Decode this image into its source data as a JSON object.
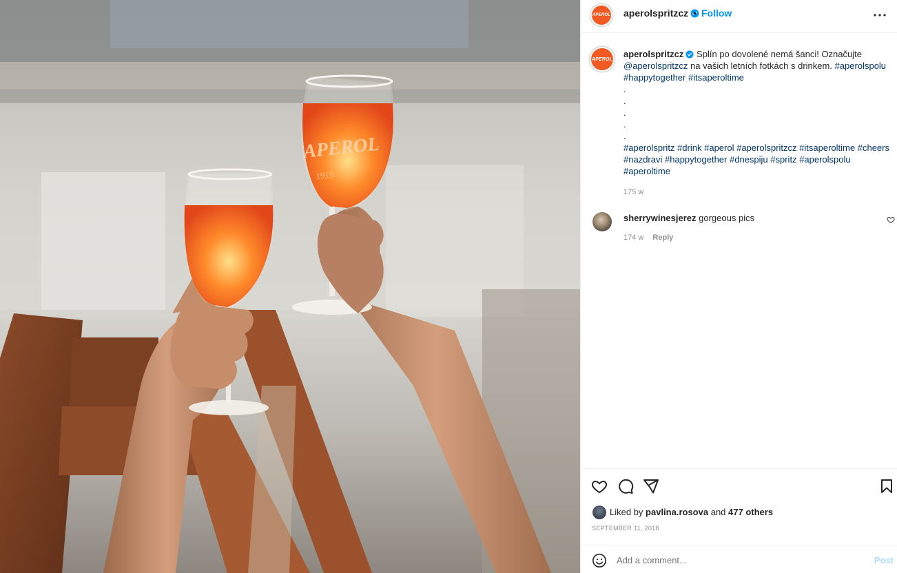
{
  "post": {
    "username": "aperolspritzcz",
    "avatar_text": "APEROL",
    "follow_label": "Follow",
    "dot": "•",
    "caption": {
      "text_1": "Splín po dovolené nemá šanci! Označujte",
      "mention": "@aperolspritzcz",
      "text_2": "na vašich letních fotkách s drinkem.",
      "tags_line1": [
        "#aperolspolu",
        "#happytogether",
        "#itsaperoltime"
      ],
      "dots": [
        ".",
        ".",
        ".",
        ".",
        "."
      ],
      "tags_line2": [
        "#aperolspritz",
        "#drink",
        "#aperol",
        "#aperolspritzcz",
        "#itsaperoltime",
        "#cheers",
        "#nazdravi",
        "#happytogether",
        "#dnespiju",
        "#spritz",
        "#aperolspolu",
        "#aperoltime"
      ],
      "age": "175 w"
    }
  },
  "comments": [
    {
      "username": "sherrywinesjerez",
      "text": "gorgeous pics",
      "age": "174 w",
      "reply_label": "Reply"
    }
  ],
  "likes": {
    "prefix": "Liked by",
    "user": "pavlina.rosova",
    "conj": "and",
    "others": "477 others"
  },
  "date": "SEPTEMBER 11, 2018",
  "add_comment": {
    "placeholder": "Add a comment...",
    "post_label": "Post"
  },
  "photo": {
    "glass_brand": "APEROL",
    "glass_year": "1919"
  },
  "colors": {
    "accent": "#0095f6",
    "hashtag": "#00376b",
    "brand": "#f15a22",
    "post_disabled": "#b3dbff"
  },
  "icons": [
    "more-icon",
    "verified-icon",
    "heart-icon",
    "comment-icon",
    "share-icon",
    "bookmark-icon",
    "emoji-icon"
  ]
}
